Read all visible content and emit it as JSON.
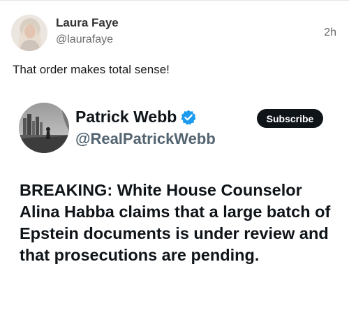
{
  "reply": {
    "author_name": "Laura Faye",
    "author_handle": "@laurafaye",
    "timestamp": "2h",
    "text": "That order makes total sense!"
  },
  "embedded_post": {
    "author_name": "Patrick Webb",
    "author_handle": "@RealPatrickWebb",
    "verified_icon": "verified-badge-icon",
    "subscribe_label": "Subscribe",
    "text": "BREAKING: White House Counselor Alina Habba claims that a large batch of Epstein documents is under review and that prosecutions are pending."
  },
  "colors": {
    "verified_blue": "#1d9bf0",
    "subscribe_bg": "#0f1419",
    "secondary_text": "#6b6b6b"
  }
}
